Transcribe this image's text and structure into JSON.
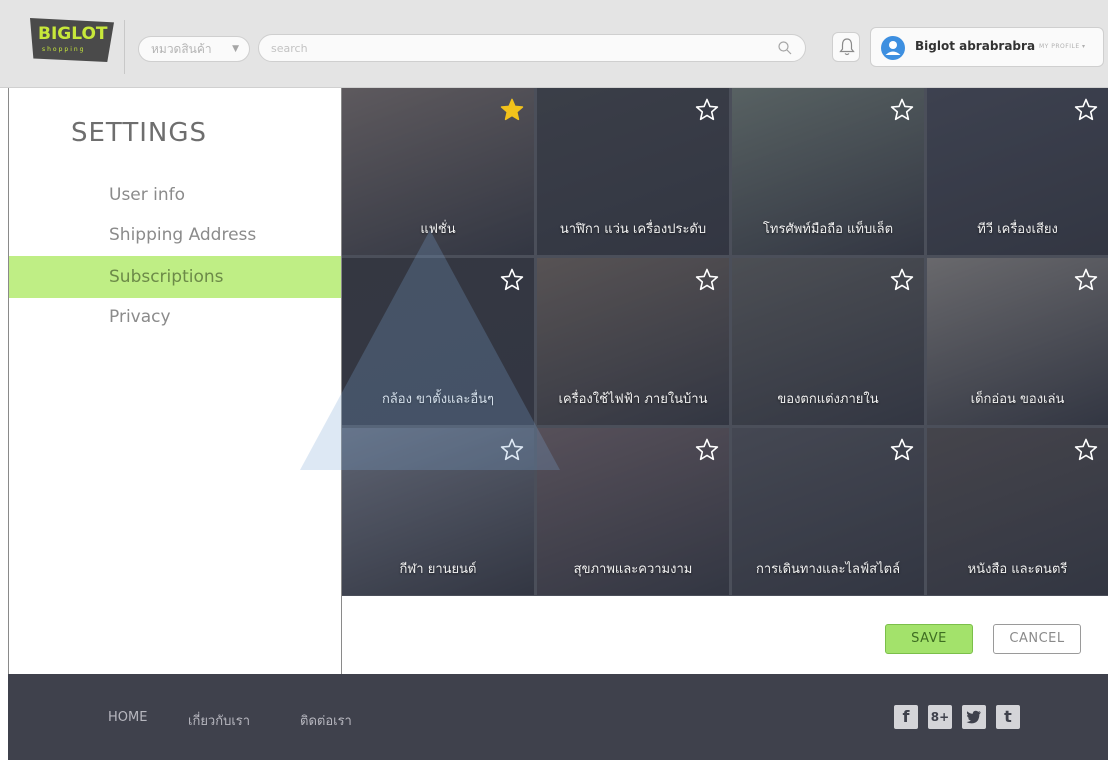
{
  "header": {
    "logo_text": "BIGLOT",
    "logo_sub": "shopping",
    "category_select": "หมวดสินค้า",
    "search_placeholder": "search",
    "user_name": "Biglot abrabrabra",
    "my_profile": "MY PROFILE"
  },
  "sidebar": {
    "title": "SETTINGS",
    "items": [
      {
        "label": "User info"
      },
      {
        "label": "Shipping Address"
      },
      {
        "label": "Subscriptions"
      },
      {
        "label": "Privacy"
      }
    ]
  },
  "tiles": [
    {
      "label": "แฟชั่น",
      "starred": true,
      "color": "#7a6f6a"
    },
    {
      "label": "นาฬิกา แว่น เครื่องประดับ",
      "starred": false,
      "color": "#3a3d42"
    },
    {
      "label": "โทรศัพท์มือถือ แท็บเล็ต",
      "starred": false,
      "color": "#6f7d72"
    },
    {
      "label": "ทีวี เครื่องเสียง",
      "starred": false,
      "color": "#3f4350"
    },
    {
      "label": "กล้อง ขาตั้งและอื่นๆ",
      "starred": false,
      "color": "#2f3136"
    },
    {
      "label": "เครื่องใช้ไฟฟ้า ภายในบ้าน",
      "starred": false,
      "color": "#6e6258"
    },
    {
      "label": "ของตกแต่งภายใน",
      "starred": false,
      "color": "#5a5b58"
    },
    {
      "label": "เด็กอ่อน ของเล่น",
      "starred": false,
      "color": "#8e8a84"
    },
    {
      "label": "กีฬา ยานยนต์",
      "starred": false,
      "color": "#7c8290"
    },
    {
      "label": "สุขภาพและความงาม",
      "starred": false,
      "color": "#6d5d62"
    },
    {
      "label": "การเดินทางและไลฟ์สไตล์",
      "starred": false,
      "color": "#4c4e55"
    },
    {
      "label": "หนังสือ และดนตรี",
      "starred": false,
      "color": "#4d4848"
    }
  ],
  "actions": {
    "save": "SAVE",
    "cancel": "CANCEL"
  },
  "footer": {
    "links": [
      {
        "label": "HOME"
      },
      {
        "label": "เกี่ยวกับเรา"
      },
      {
        "label": "ติดต่อเรา"
      }
    ],
    "social": [
      {
        "name": "facebook",
        "glyph": "f"
      },
      {
        "name": "google-plus",
        "glyph": "8+"
      },
      {
        "name": "twitter",
        "glyph": "t"
      },
      {
        "name": "tumblr",
        "glyph": "t"
      }
    ]
  },
  "colors": {
    "accent_green": "#bfee85",
    "star_active": "#f2c21b",
    "footer_bg": "#3f414c"
  }
}
